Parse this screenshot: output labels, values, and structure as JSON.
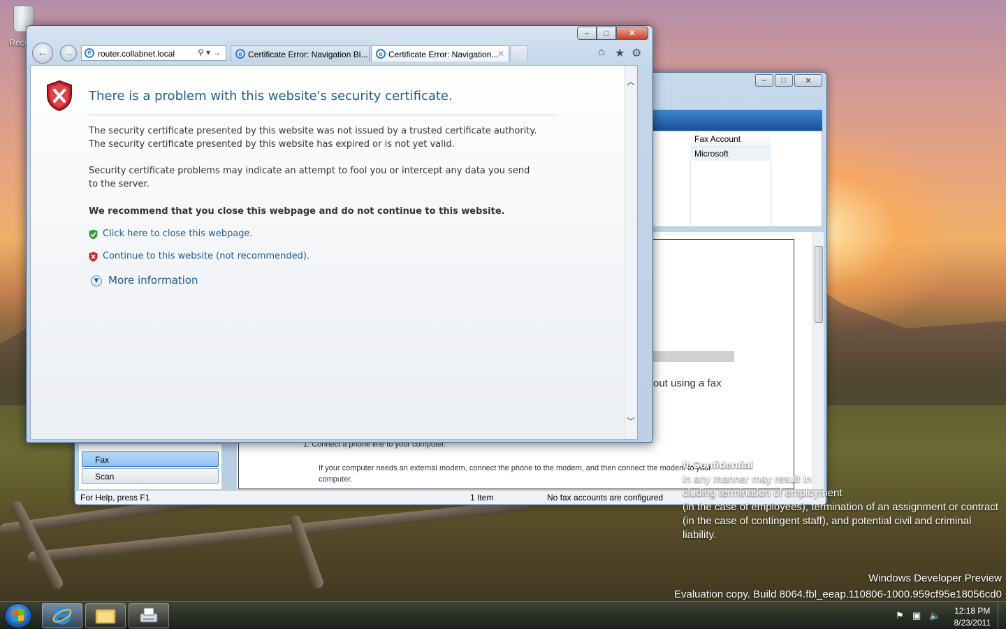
{
  "desktop": {
    "recycle_label": "Recyc",
    "confidential": {
      "heading": "ft Confidential",
      "lines": [
        "in any manner may result in",
        "cluding termination of employment",
        "(in the case of employees), termination of an assignment or contract",
        "(in the case of contingent staff), and potential civil and criminal",
        "liability."
      ]
    },
    "watermark": {
      "line1": "Windows Developer Preview",
      "line2": "Evaluation copy. Build 8064.fbl_eeap.110806-1000.959cf95e18056cd0"
    }
  },
  "fax_window": {
    "list_header": "Fax Account",
    "list_cell": "Microsoft",
    "preview_partial": "out using a fax",
    "step_text": "1.   Connect a phone line to your computer.",
    "step_para": "If your computer needs an external modem, connect the phone to the modem, and then connect the modem to your computer.",
    "nav_fax": "Fax",
    "nav_scan": "Scan",
    "status_help": "For Help, press F1",
    "status_count": "1 Item",
    "status_accounts": "No fax accounts are configured"
  },
  "ie": {
    "address": "router.collabnet.local",
    "tabs": [
      {
        "label": "Certificate Error: Navigation Bl..."
      },
      {
        "label": "Certificate Error: Navigation..."
      }
    ],
    "content": {
      "title": "There is a problem with this website's security certificate.",
      "p1": "The security certificate presented by this website was not issued by a trusted certificate authority.",
      "p2": "The security certificate presented by this website has expired or is not yet valid.",
      "p3": "Security certificate problems may indicate an attempt to fool you or intercept any data you send to the server.",
      "recommend": "We recommend that you close this webpage and do not continue to this website.",
      "link_close": "Click here to close this webpage.",
      "link_continue": "Continue to this website (not recommended).",
      "more_info": "More information"
    }
  },
  "taskbar": {
    "time": "12:18 PM",
    "date": "8/23/2011"
  },
  "colors": {
    "link_blue": "#1e5b8f",
    "shield_red": "#c8232c",
    "shield_green": "#3a9a3a"
  },
  "icons": [
    "recycle-bin-icon",
    "ie-icon",
    "search-icon",
    "refresh-icon",
    "home-icon",
    "favorites-star-icon",
    "gear-icon",
    "red-shield-x-icon",
    "green-shield-check-icon",
    "red-shield-small-icon",
    "expand-circle-icon",
    "start-orb-icon",
    "explorer-folder-icon",
    "fax-printer-icon",
    "flag-icon",
    "network-icon",
    "speaker-muted-icon"
  ]
}
